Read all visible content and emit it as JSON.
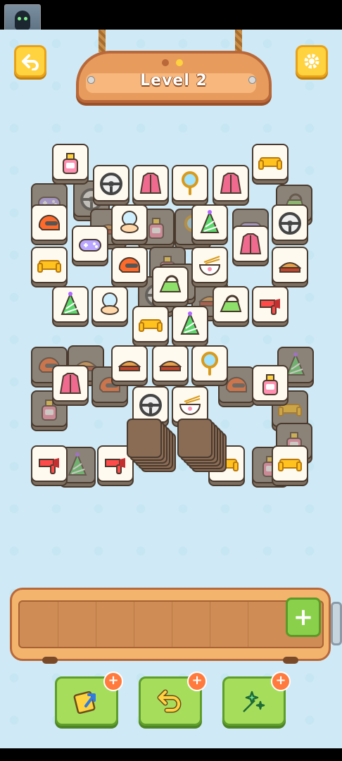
{
  "header": {
    "level_title": "Level 2",
    "back_icon": "back-arrow-icon",
    "settings_icon": "gear-icon",
    "progress_dots": [
      "inactive",
      "active"
    ]
  },
  "tray": {
    "add_slot_label": "+",
    "slot_count": 7
  },
  "powerups": [
    {
      "name": "shuffle",
      "icon": "shuffle-tile-icon",
      "badge": "+"
    },
    {
      "name": "undo",
      "icon": "undo-icon",
      "badge": "+"
    },
    {
      "name": "magic",
      "icon": "magic-wand-icon",
      "badge": "+"
    }
  ],
  "tile_types": [
    "perfume",
    "steering-wheel",
    "jacket",
    "hand-mirror",
    "sofa",
    "helmet",
    "gamepad",
    "compact-mirror",
    "party-hat",
    "noodle-bowl",
    "hair-dryer",
    "iron",
    "sandwich"
  ],
  "colors": {
    "background": "#cfeaf6",
    "tile_face": "#fffaf0",
    "button_yellow": "#ffd23f",
    "button_green": "#a6de5c",
    "sign_wood": "#e79b5c"
  }
}
